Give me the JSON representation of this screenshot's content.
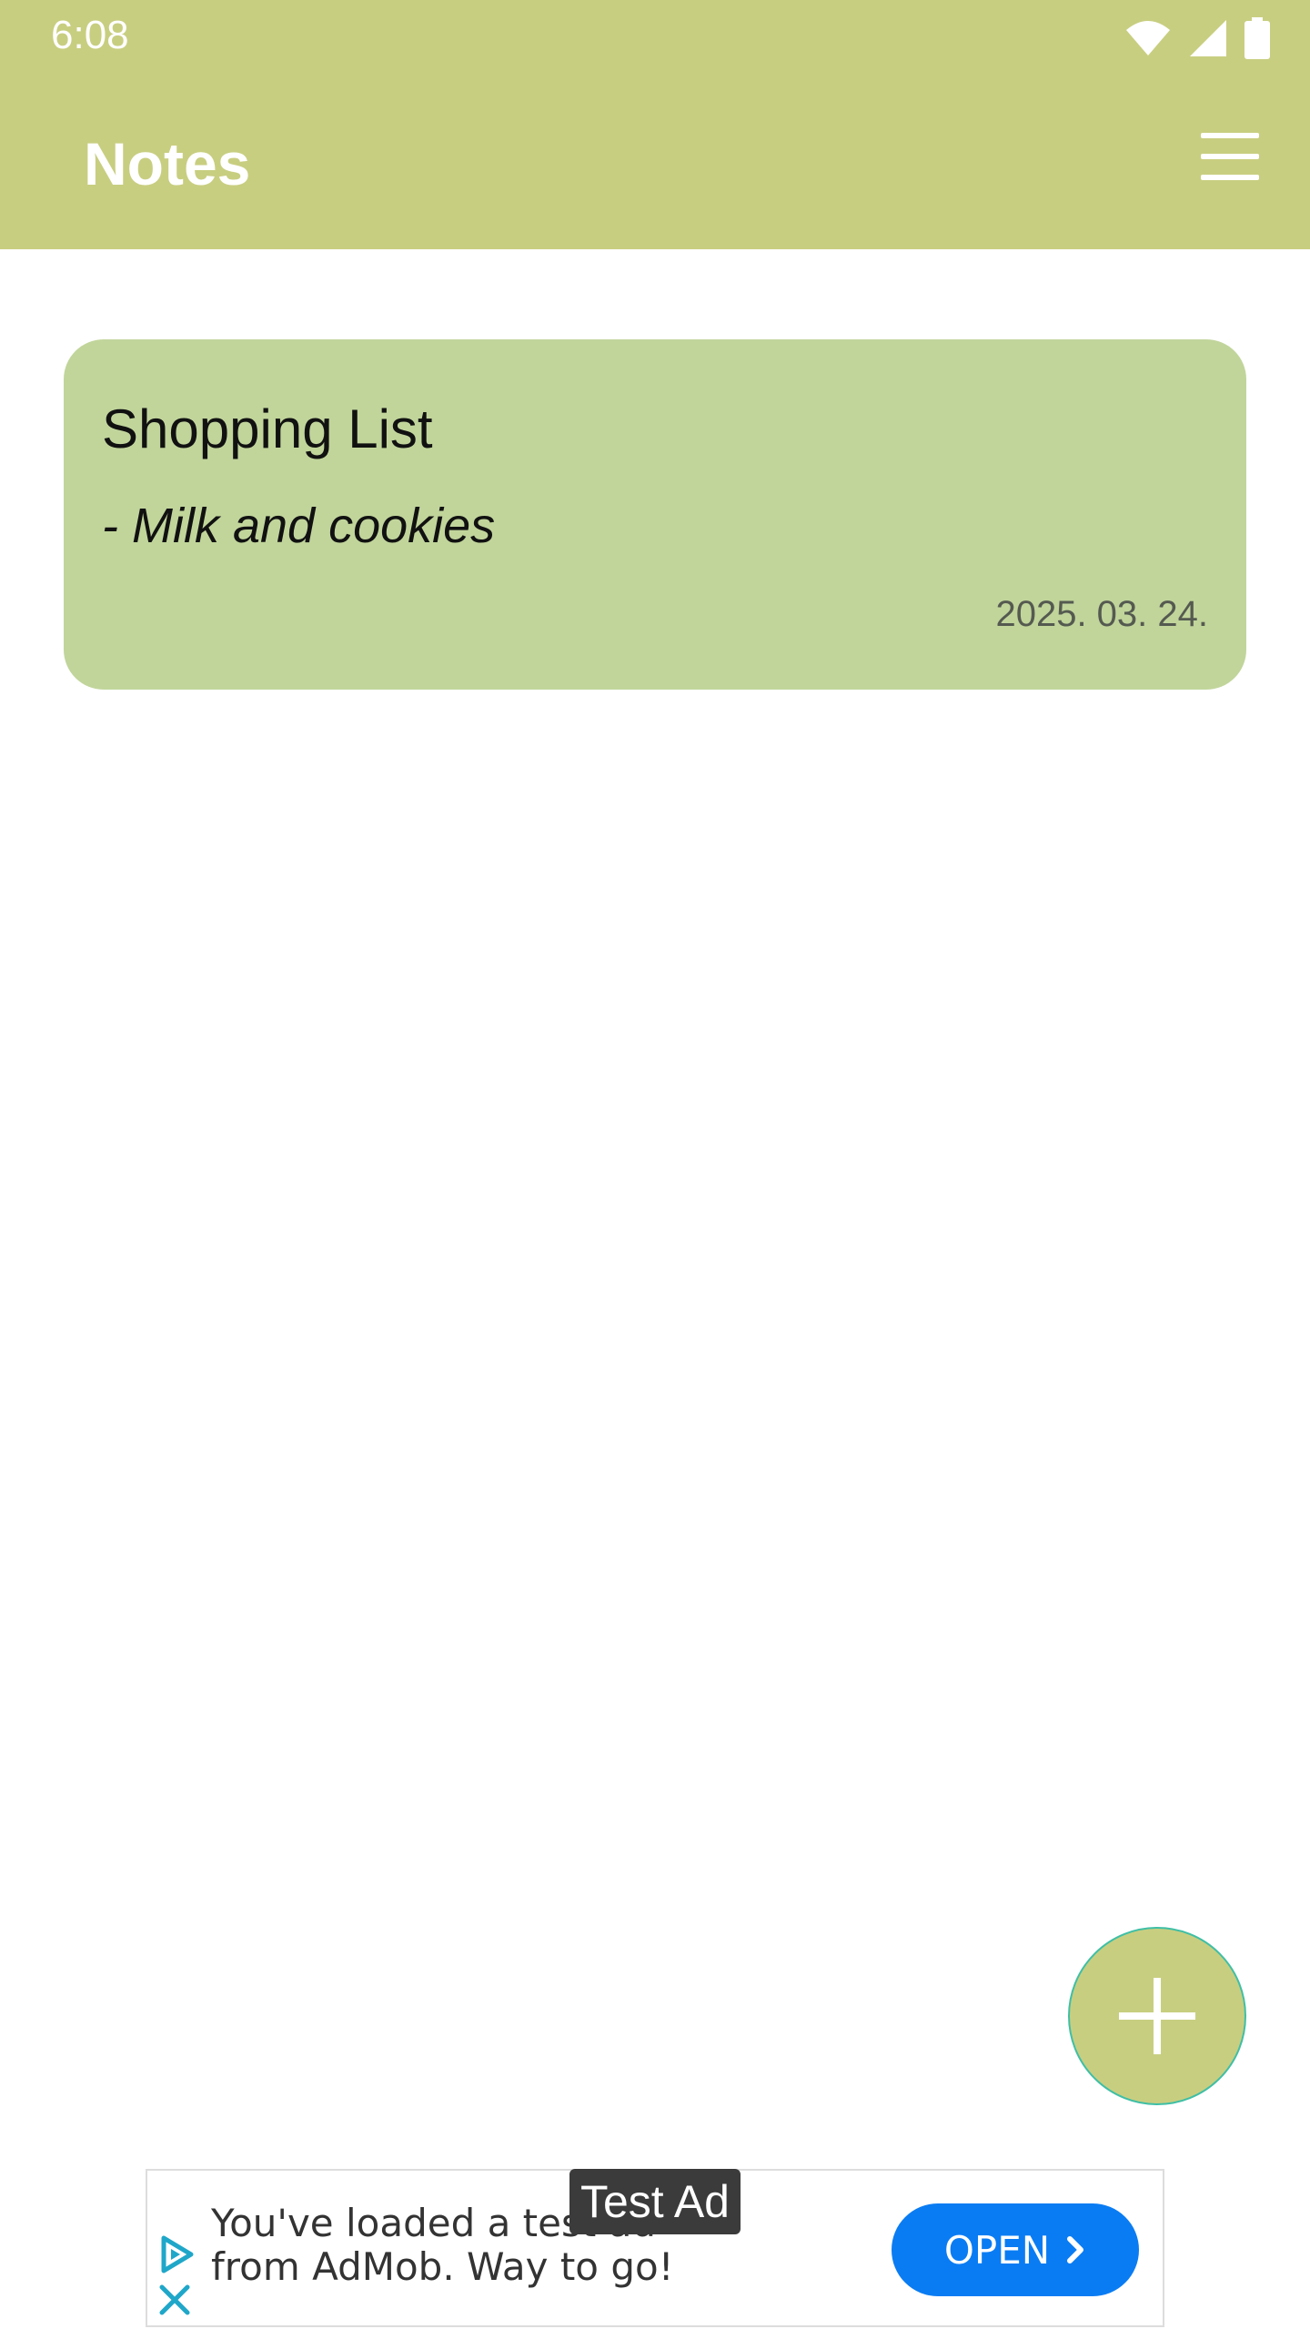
{
  "status_bar": {
    "time": "6:08",
    "icons": [
      "wifi-icon",
      "cellular-signal-icon",
      "battery-icon"
    ]
  },
  "app_bar": {
    "title": "Notes",
    "menu_icon": "menu-icon"
  },
  "notes": [
    {
      "title": "Shopping List",
      "body": "- Milk and cookies",
      "date": "2025. 03. 24.",
      "color": "#c1d59b"
    }
  ],
  "fab": {
    "icon": "add-icon"
  },
  "ad": {
    "label": "Test Ad",
    "text": "You've loaded a test ad from AdMob. Way to go!",
    "button_label": "OPEN",
    "icons": [
      "adchoices-play-icon",
      "close-icon",
      "chevron-right-icon"
    ]
  },
  "colors": {
    "primary": "#c8ce80",
    "note_card": "#c1d59b",
    "ad_button": "#0a7cf3"
  }
}
